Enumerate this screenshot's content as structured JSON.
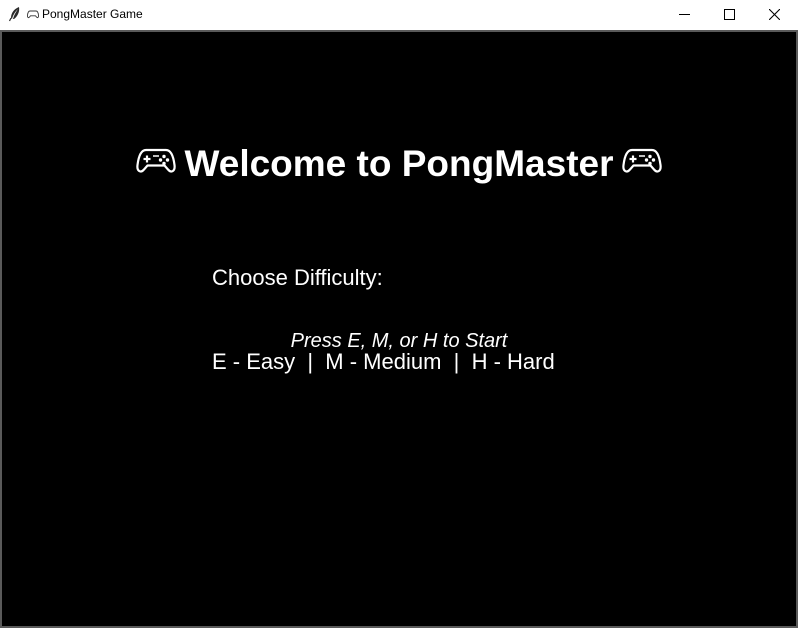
{
  "window": {
    "title": "PongMaster Game",
    "icons": {
      "app": "feather-icon",
      "title_prefix": "gamepad-outline-icon",
      "minimize": "minimize-icon",
      "maximize": "maximize-icon",
      "close": "close-icon"
    }
  },
  "game": {
    "background_color": "#000000",
    "text_color": "#ffffff",
    "heading": "Welcome to PongMaster",
    "heading_icon": "gamepad-icon",
    "difficulty_title": "Choose Difficulty:",
    "difficulty_options": "E - Easy  |  M - Medium  |  H - Hard",
    "start_prompt": "Press E, M, or H to Start"
  }
}
